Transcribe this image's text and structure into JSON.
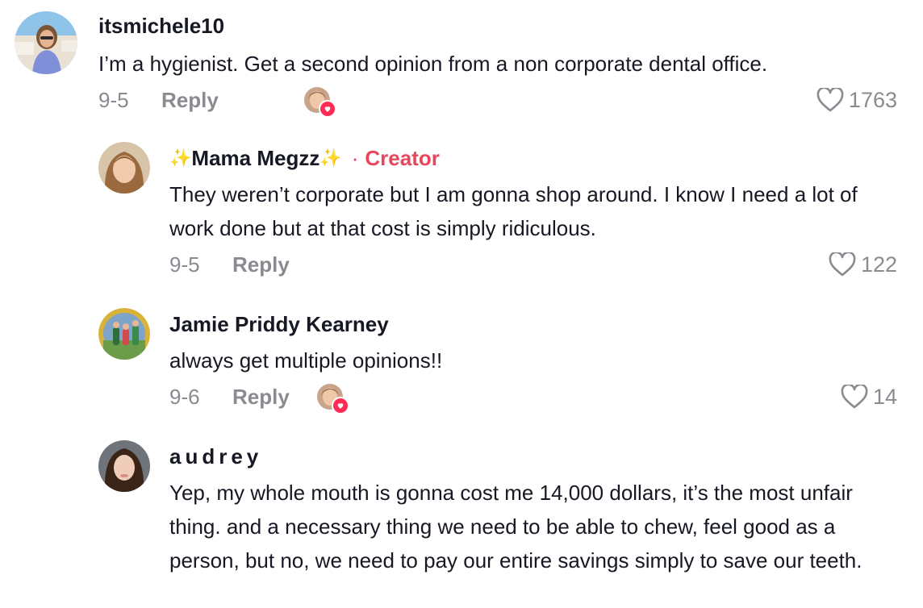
{
  "comments": [
    {
      "username": "itsmichele10",
      "text": "I’m a hygienist. Get a second opinion from a non corporate dental office.",
      "date": "9-5",
      "reply_label": "Reply",
      "likes": "1763",
      "liked_by_creator": true
    },
    {
      "username": "Mama Megzz",
      "sparkle_left": "✨",
      "sparkle_right": "✨",
      "separator": "·",
      "creator_tag": "Creator",
      "text": "They weren’t corporate but I am gonna shop around. I know I need a lot of work done but at that cost is simply ridiculous.",
      "date": "9-5",
      "reply_label": "Reply",
      "likes": "122",
      "liked_by_creator": false
    },
    {
      "username": "Jamie Priddy Kearney",
      "text": "always get multiple opinions!!",
      "date": "9-6",
      "reply_label": "Reply",
      "likes": "14",
      "liked_by_creator": true
    },
    {
      "username": "audrey",
      "text": "Yep, my whole mouth is gonna cost me 14,000 dollars, it’s the most unfair thing. and a necessary thing we need to be able to chew, feel good as a person, but no, we need to pay our entire savings simply to save our teeth."
    }
  ],
  "colors": {
    "creator": "#e8465b",
    "meta": "#8a8b91",
    "heart_badge": "#fe2c55"
  },
  "icons": {
    "like": "heart-outline-icon",
    "liked_badge": "heart-badge-icon"
  }
}
